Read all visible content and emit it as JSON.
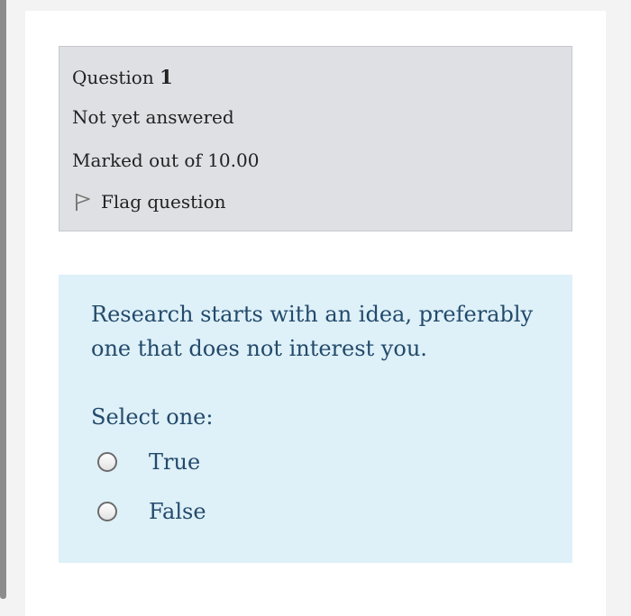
{
  "question_info": {
    "label": "Question",
    "number": "1",
    "state": "Not yet answered",
    "grade": "Marked out of 10.00",
    "flag_label": "Flag question"
  },
  "question": {
    "text": "Research starts with an idea, preferably one that does not interest you.",
    "prompt": "Select one:",
    "options": [
      {
        "label": "True",
        "selected": false
      },
      {
        "label": "False",
        "selected": false
      }
    ]
  },
  "colors": {
    "info_background": "#dfe0e4",
    "content_background": "#def0f8",
    "question_text": "#234a6b"
  }
}
